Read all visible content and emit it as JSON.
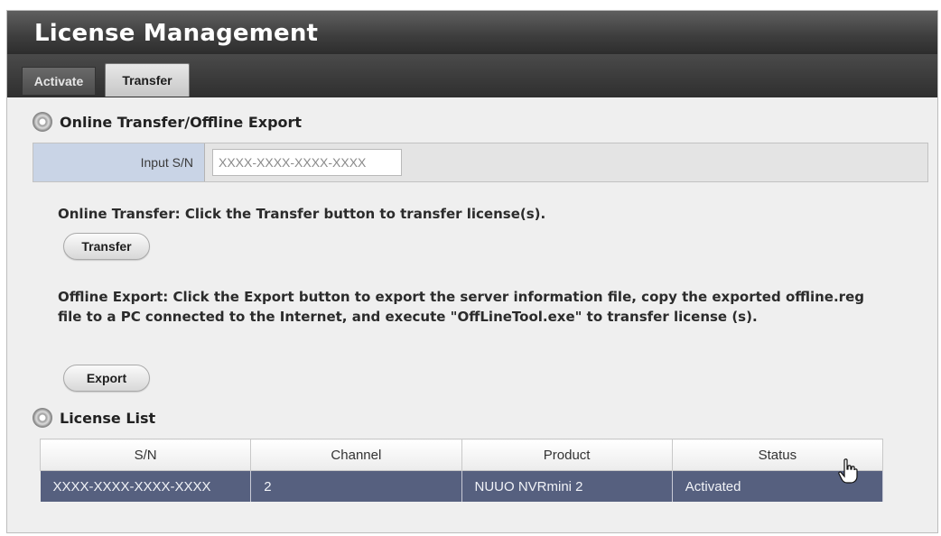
{
  "header": {
    "title": "License Management"
  },
  "tabs": [
    {
      "label": "Activate",
      "active": false
    },
    {
      "label": "Transfer",
      "active": true
    }
  ],
  "transfer_section": {
    "heading": "Online Transfer/Offline Export",
    "sn_label": "Input S/N",
    "sn_placeholder": "XXXX-XXXX-XXXX-XXXX",
    "online_text": "Online Transfer: Click the Transfer button to transfer license(s).",
    "transfer_button": "Transfer",
    "offline_text": "Offline Export: Click the Export button to export the server information file, copy the exported offline.reg file to a PC connected to the Internet, and execute \"OffLineTool.exe\" to transfer license (s).",
    "export_button": "Export"
  },
  "license_list": {
    "heading": "License List",
    "columns": [
      "S/N",
      "Channel",
      "Product",
      "Status"
    ],
    "rows": [
      [
        "XXXX-XXXX-XXXX-XXXX",
        "2",
        "NUUO NVRmini 2",
        "Activated"
      ]
    ]
  },
  "icons": {
    "section_icon": "disc-icon",
    "cursor": "hand-pointer-icon"
  },
  "colors": {
    "selected_row": "#56607f",
    "label_cell": "#c9d4e6",
    "title_bar": "#3d3d3d"
  }
}
